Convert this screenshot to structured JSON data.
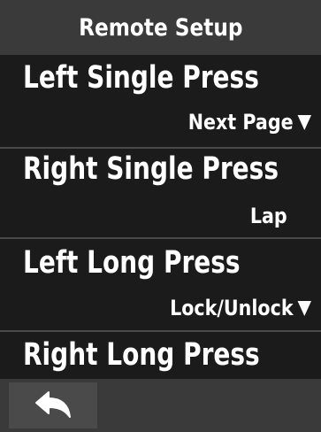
{
  "header": {
    "title": "Remote Setup"
  },
  "rows": [
    {
      "label": "Left Single Press",
      "value": "Next Page",
      "has_dropdown": true
    },
    {
      "label": "Right Single Press",
      "value": "Lap",
      "has_dropdown": false
    },
    {
      "label": "Left Long Press",
      "value": "Lock/Unlock",
      "has_dropdown": true
    },
    {
      "label": "Right Long Press",
      "value": "",
      "has_dropdown": false
    }
  ],
  "footer": {
    "back_icon": "back-arrow-icon"
  },
  "colors": {
    "background": "#1b1b1b",
    "header": "#3a3a3a",
    "footer": "#3a3a3a",
    "back_button": "#4a4a4a",
    "divider": "#4a4a4a",
    "text": "#ffffff"
  }
}
